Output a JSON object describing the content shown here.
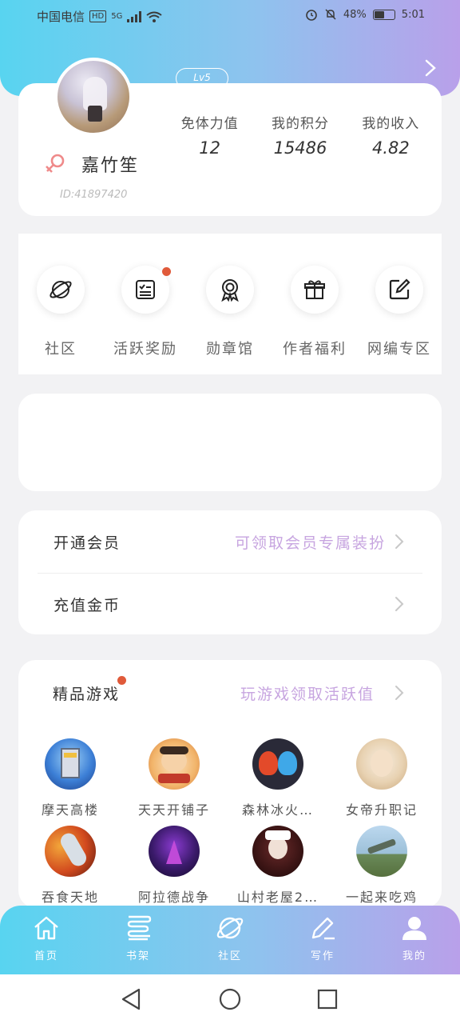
{
  "status_bar": {
    "carrier": "中国电信",
    "hd": "HD",
    "network": "5G",
    "battery_text": "48%",
    "battery_level": 0.48,
    "time": "5:01"
  },
  "profile": {
    "level": "Lv5",
    "username": "嘉竹笙",
    "user_id": "ID:41897420",
    "stats": [
      {
        "label": "免体力值",
        "value": "12"
      },
      {
        "label": "我的积分",
        "value": "15486"
      },
      {
        "label": "我的收入",
        "value": "4.82"
      }
    ]
  },
  "quick_menu": [
    {
      "label": "社区",
      "icon": "planet-icon",
      "badge": false
    },
    {
      "label": "活跃奖励",
      "icon": "checklist-icon",
      "badge": true
    },
    {
      "label": "勋章馆",
      "icon": "medal-icon",
      "badge": false
    },
    {
      "label": "作者福利",
      "icon": "gift-icon",
      "badge": false
    },
    {
      "label": "网编专区",
      "icon": "edit-icon",
      "badge": false
    }
  ],
  "member": {
    "vip_title": "开通会员",
    "vip_sub": "可领取会员专属装扮",
    "recharge_title": "充值金币"
  },
  "games": {
    "title": "精品游戏",
    "sub": "玩游戏领取活跃值",
    "items": [
      {
        "name": "摩天高楼"
      },
      {
        "name": "天天开铺子"
      },
      {
        "name": "森林冰火…"
      },
      {
        "name": "女帝升职记"
      },
      {
        "name": "吞食天地"
      },
      {
        "name": "阿拉德战争"
      },
      {
        "name": "山村老屋2…"
      },
      {
        "name": "一起来吃鸡"
      }
    ]
  },
  "bottom_nav": [
    {
      "label": "首页",
      "icon": "home-icon"
    },
    {
      "label": "书架",
      "icon": "bookshelf-icon"
    },
    {
      "label": "社区",
      "icon": "planet-icon"
    },
    {
      "label": "写作",
      "icon": "pen-icon"
    },
    {
      "label": "我的",
      "icon": "profile-icon"
    }
  ],
  "colors": {
    "gradient_start": "#58d4f0",
    "gradient_end": "#b9a0ea",
    "accent_purple": "#c7a5e0",
    "badge_red": "#e05a3a",
    "female_pink": "#ef8a8a"
  }
}
